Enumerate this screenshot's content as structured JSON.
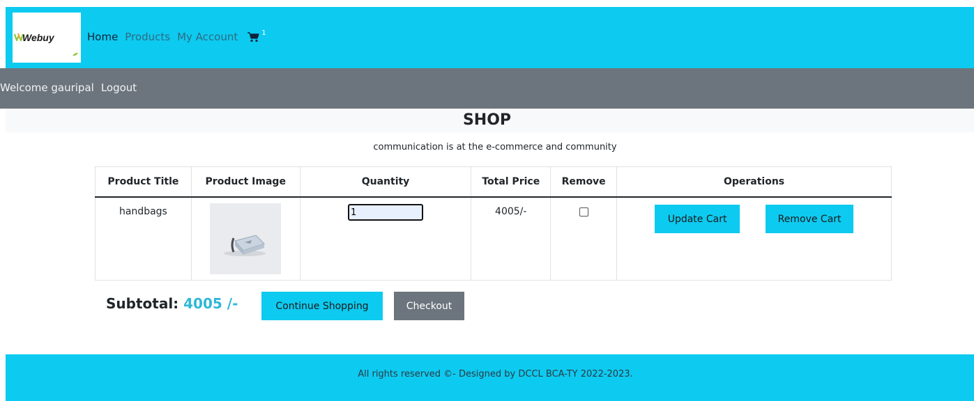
{
  "brand": {
    "name": "Webuy",
    "colors": {
      "primary": "#0dcaf0",
      "secondary": "#6c757d",
      "subtotal_amount": "#2fb8d8"
    }
  },
  "nav": {
    "items": [
      {
        "label": "Home"
      },
      {
        "label": "Products"
      },
      {
        "label": "My Account"
      }
    ],
    "cart_icon": "cart-icon",
    "cart_count": "1"
  },
  "user_bar": {
    "welcome": "Welcome gauripal",
    "logout": "Logout"
  },
  "shop": {
    "title": "SHOP",
    "tagline": "communication is at the e-commerce and community"
  },
  "cart_table": {
    "headers": [
      "Product Title",
      "Product Image",
      "Quantity",
      "Total Price",
      "Remove",
      "Operations"
    ],
    "rows": [
      {
        "title": "handbags",
        "image_icon": "handbag-image",
        "quantity": "1",
        "total_price": "4005/-",
        "remove_checked": false
      }
    ],
    "update_label": "Update Cart",
    "remove_label": "Remove Cart"
  },
  "summary": {
    "subtotal_label": "Subtotal:",
    "subtotal_value": "4005 /-",
    "continue_label": "Continue Shopping",
    "checkout_label": "Checkout"
  },
  "footer": {
    "text": "All rights reserved ©- Designed by DCCL BCA-TY 2022-2023."
  }
}
